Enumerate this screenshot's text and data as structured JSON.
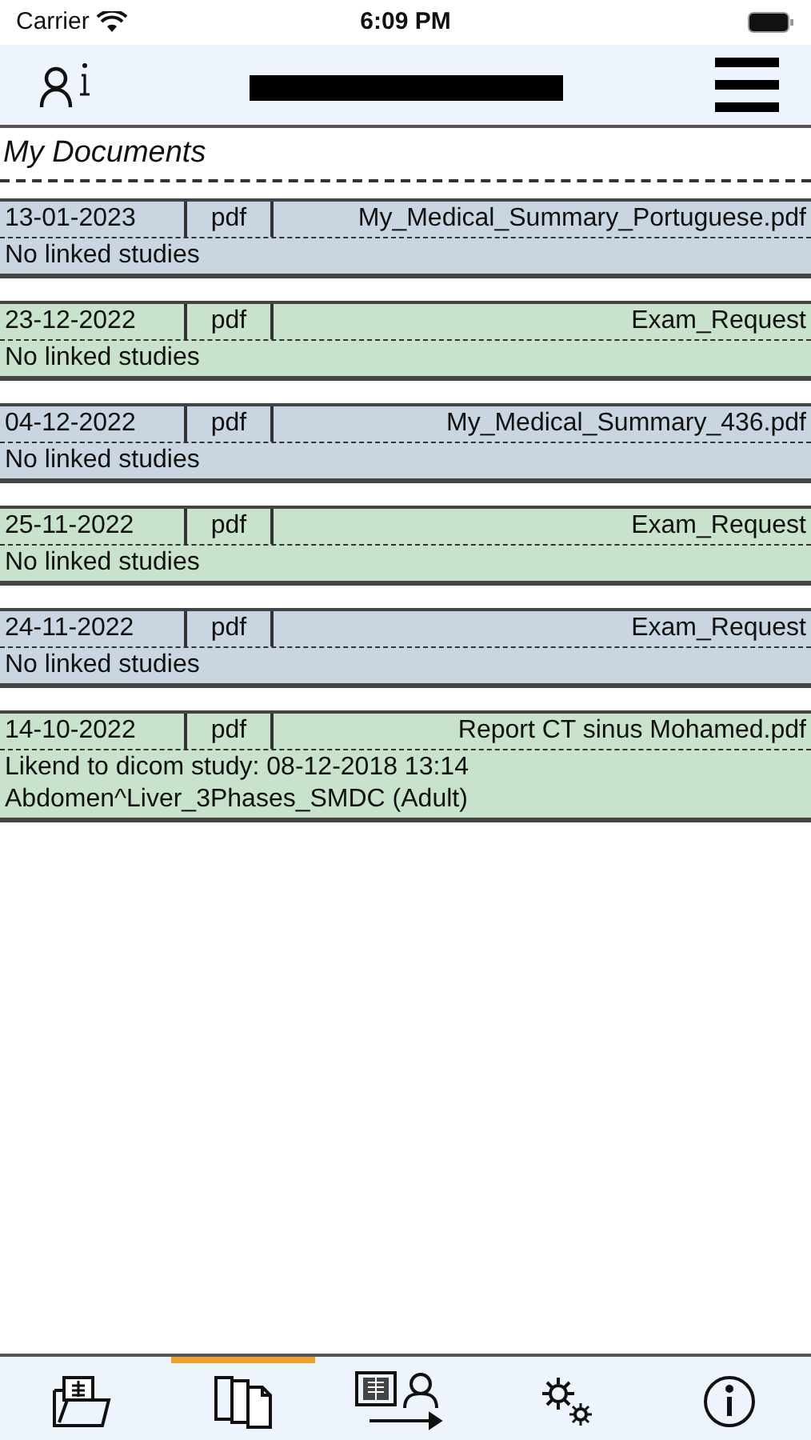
{
  "status_bar": {
    "carrier": "Carrier",
    "time": "6:09 PM"
  },
  "header": {
    "title_redacted": true
  },
  "section_title": "My Documents",
  "documents": [
    {
      "date": "13-01-2023",
      "type": "pdf",
      "name": "My_Medical_Summary_Portuguese.pdf",
      "color": "#c9d5e1",
      "studies": [
        "No linked studies"
      ]
    },
    {
      "date": "23-12-2022",
      "type": "pdf",
      "name": "Exam_Request",
      "color": "#c8e2cb",
      "studies": [
        "No linked studies"
      ]
    },
    {
      "date": "04-12-2022",
      "type": "pdf",
      "name": "My_Medical_Summary_436.pdf",
      "color": "#c9d5e1",
      "studies": [
        "No linked studies"
      ]
    },
    {
      "date": "25-11-2022",
      "type": "pdf",
      "name": "Exam_Request",
      "color": "#c8e2cb",
      "studies": [
        "No linked studies"
      ]
    },
    {
      "date": "24-11-2022",
      "type": "pdf",
      "name": "Exam_Request",
      "color": "#c9d5e1",
      "studies": [
        "No linked studies"
      ]
    },
    {
      "date": "14-10-2022",
      "type": "pdf",
      "name": "Report CT sinus Mohamed.pdf",
      "color": "#c8e2cb",
      "studies": [
        "Likend to dicom study: 08-12-2018 13:14",
        "Abdomen^Liver_3Phases_SMDC (Adult)"
      ]
    }
  ],
  "tab_bar": [
    {
      "kind": "folder",
      "selected": false
    },
    {
      "kind": "documents",
      "selected": true
    },
    {
      "kind": "transfer",
      "selected": false
    },
    {
      "kind": "settings",
      "selected": false
    },
    {
      "kind": "info",
      "selected": false
    }
  ]
}
